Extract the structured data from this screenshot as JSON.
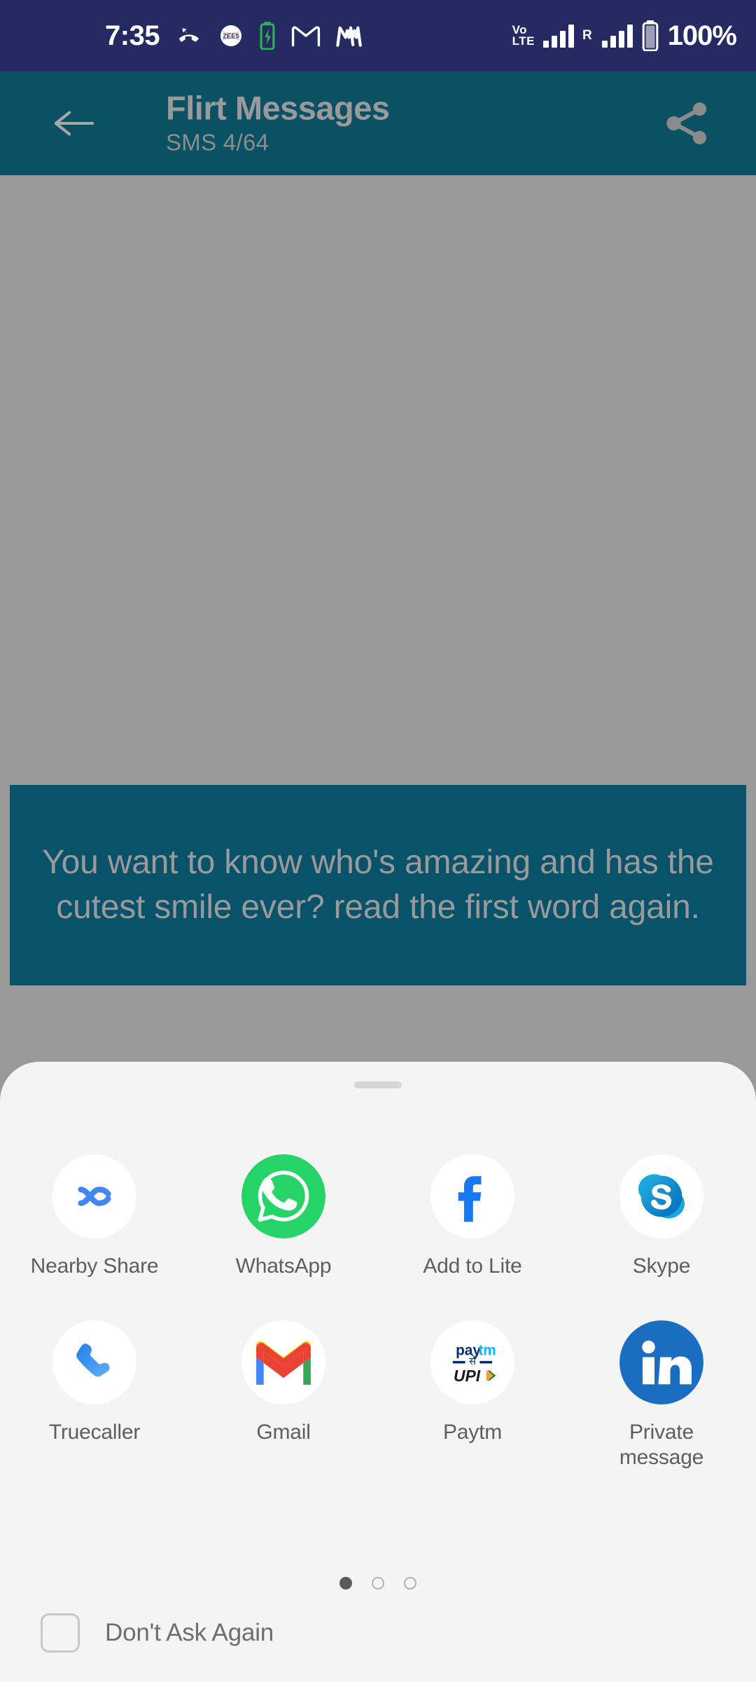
{
  "status_bar": {
    "time": "7:35",
    "battery_percent": "100%",
    "network_label_top": "Vo",
    "network_label_bottom": "LTE",
    "roaming_label": "R",
    "icons": [
      "missed-call-icon",
      "zee5-icon",
      "battery-charging-icon",
      "gmail-icon",
      "m-app-icon"
    ],
    "colors": {
      "background": "#262a63",
      "foreground": "#ffffff",
      "battery_charging": "#25b84c"
    }
  },
  "app_bar": {
    "back_label": "back-arrow",
    "title": "Flirt Messages",
    "subtitle": "SMS  4/64",
    "share_label": "share",
    "colors": {
      "background": "#0a5163",
      "text": "#9a9a9a"
    }
  },
  "message_card": {
    "text": "You want to know who's amazing and has the cutest smile ever? read the first word again.",
    "colors": {
      "background": "#08536a",
      "text": "#9a9a9a"
    }
  },
  "share_sheet": {
    "background": "#f4f4f4",
    "handle": "drag-handle",
    "rows": [
      [
        {
          "label": "Nearby Share",
          "icon": "nearby-share-icon"
        },
        {
          "label": "WhatsApp",
          "icon": "whatsapp-icon"
        },
        {
          "label": "Add to Lite",
          "icon": "facebook-icon"
        },
        {
          "label": "Skype",
          "icon": "skype-icon"
        }
      ],
      [
        {
          "label": "Truecaller",
          "icon": "truecaller-icon"
        },
        {
          "label": "Gmail",
          "icon": "gmail-icon"
        },
        {
          "label": "Paytm",
          "icon": "paytm-upi-icon"
        },
        {
          "label": "Private message",
          "icon": "linkedin-icon"
        }
      ]
    ],
    "pagination": {
      "total": 3,
      "active_index": 0
    },
    "dont_ask_again": {
      "label": "Don't Ask Again",
      "checked": false
    }
  }
}
